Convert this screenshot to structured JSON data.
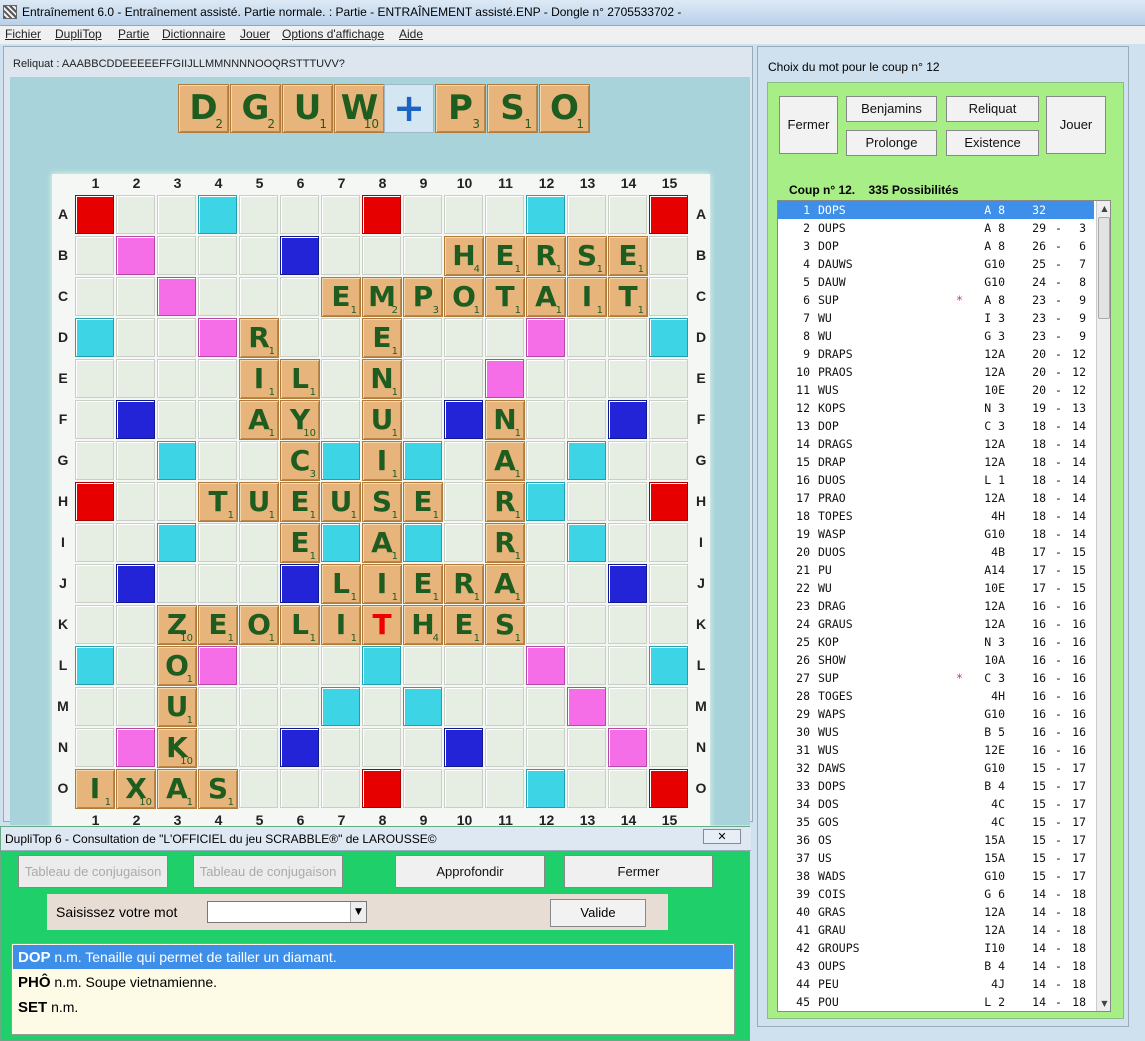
{
  "titlebar": {
    "title": "Entraînement 6.0 - Entraînement assisté. Partie normale. : Partie - ENTRAÎNEMENT assisté.ENP - Dongle n° 2705533702 -"
  },
  "menu": [
    "Fichier",
    "DupliTop",
    "Partie",
    "Dictionnaire",
    "Jouer",
    "Options d'affichage",
    "Aide"
  ],
  "reliquat": "Reliquat : AAABBCDDEEEEEFFGIIJLLMMNNNNOOQRSTTTUVV?",
  "rack": [
    [
      "D",
      "2"
    ],
    [
      "G",
      "2"
    ],
    [
      "U",
      "1"
    ],
    [
      "W",
      "10"
    ],
    [
      "P",
      "3"
    ],
    [
      "S",
      "1"
    ],
    [
      "O",
      "1"
    ]
  ],
  "rack_plus": "+",
  "cols": [
    "1",
    "2",
    "3",
    "4",
    "5",
    "6",
    "7",
    "8",
    "9",
    "10",
    "11",
    "12",
    "13",
    "14",
    "15"
  ],
  "rows": [
    "A",
    "B",
    "C",
    "D",
    "E",
    "F",
    "G",
    "H",
    "I",
    "J",
    "K",
    "L",
    "M",
    "N",
    "O"
  ],
  "colors": {
    "tw": "#e60000",
    "dw": "#f56ee8",
    "tl": "#2323d8",
    "dl": "#3dd5e5",
    "tile": "#e7b57b",
    "letter": "#1f5c1f",
    "selected": "#3d8fe9"
  },
  "placed": [
    [
      "B",
      9,
      "H",
      "4"
    ],
    [
      "B",
      10,
      "E",
      "1"
    ],
    [
      "B",
      11,
      "R",
      "1"
    ],
    [
      "B",
      12,
      "S",
      "1"
    ],
    [
      "B",
      13,
      "E",
      "1"
    ],
    [
      "C",
      6,
      "E",
      "1"
    ],
    [
      "C",
      7,
      "M",
      "2"
    ],
    [
      "C",
      8,
      "P",
      "3"
    ],
    [
      "C",
      9,
      "O",
      "1"
    ],
    [
      "C",
      10,
      "T",
      "1"
    ],
    [
      "C",
      11,
      "A",
      "1"
    ],
    [
      "C",
      12,
      "I",
      "1"
    ],
    [
      "C",
      13,
      "T",
      "1"
    ],
    [
      "D",
      4,
      "R",
      "1"
    ],
    [
      "D",
      7,
      "E",
      "1"
    ],
    [
      "E",
      4,
      "I",
      "1"
    ],
    [
      "E",
      5,
      "L",
      "1"
    ],
    [
      "E",
      7,
      "N",
      "1"
    ],
    [
      "F",
      4,
      "A",
      "1"
    ],
    [
      "F",
      5,
      "Y",
      "10"
    ],
    [
      "F",
      7,
      "U",
      "1"
    ],
    [
      "F",
      10,
      "N",
      "1"
    ],
    [
      "G",
      5,
      "C",
      "3"
    ],
    [
      "G",
      7,
      "I",
      "1"
    ],
    [
      "G",
      10,
      "A",
      "1"
    ],
    [
      "H",
      3,
      "T",
      "1"
    ],
    [
      "H",
      4,
      "U",
      "1"
    ],
    [
      "H",
      5,
      "E",
      "1"
    ],
    [
      "H",
      6,
      "U",
      "1"
    ],
    [
      "H",
      7,
      "S",
      "1"
    ],
    [
      "H",
      8,
      "E",
      "1"
    ],
    [
      "H",
      10,
      "R",
      "1"
    ],
    [
      "I",
      5,
      "E",
      "1"
    ],
    [
      "I",
      7,
      "A",
      "1"
    ],
    [
      "I",
      10,
      "R",
      "1"
    ],
    [
      "J",
      6,
      "L",
      "1"
    ],
    [
      "J",
      7,
      "I",
      "1"
    ],
    [
      "J",
      8,
      "E",
      "1"
    ],
    [
      "J",
      9,
      "R",
      "1"
    ],
    [
      "J",
      10,
      "A",
      "1"
    ],
    [
      "K",
      2,
      "Z",
      "10"
    ],
    [
      "K",
      3,
      "E",
      "1"
    ],
    [
      "K",
      4,
      "O",
      "1"
    ],
    [
      "K",
      5,
      "L",
      "1"
    ],
    [
      "K",
      6,
      "I",
      "1"
    ],
    [
      "K",
      7,
      "T",
      ""
    ],
    [
      "K",
      8,
      "H",
      "4"
    ],
    [
      "K",
      9,
      "E",
      "1"
    ],
    [
      "K",
      10,
      "S",
      "1"
    ],
    [
      "L",
      2,
      "O",
      "1"
    ],
    [
      "M",
      2,
      "U",
      "1"
    ],
    [
      "N",
      2,
      "K",
      "10"
    ],
    [
      "O",
      0,
      "I",
      "1"
    ],
    [
      "O",
      1,
      "X",
      "10"
    ],
    [
      "O",
      2,
      "A",
      "1"
    ],
    [
      "O",
      3,
      "S",
      "1"
    ]
  ],
  "lexique": {
    "title": "DupliTop 6 - Consultation de \"L'OFFICIEL du jeu SCRABBLE®\" de LAROUSSE©",
    "close_x": "✕",
    "btn_conj1": "Tableau de conjugaison",
    "btn_conj2": "Tableau de conjugaison",
    "btn_approfondir": "Approfondir",
    "btn_fermer": "Fermer",
    "saisir_label": "Saisissez votre mot",
    "input_value": "",
    "btn_valide": "Valide",
    "definitions": [
      {
        "word": "DOP",
        "text": " n.m. Tenaille qui permet de tailler un diamant."
      },
      {
        "word": "PHÔ",
        "text": " n.m. Soupe vietnamienne."
      },
      {
        "word": "SET",
        "text": " n.m."
      }
    ]
  },
  "choix": {
    "title": "Choix du mot pour le coup n° 12",
    "btn_fermer": "Fermer",
    "btn_benjamins": "Benjamins",
    "btn_reliquat": "Reliquat",
    "btn_prolonge": "Prolonge",
    "btn_existence": "Existence",
    "btn_jouer": "Jouer",
    "coup_label": "Coup n° 12.",
    "possibilites": "335 Possibilités",
    "moves": [
      [
        "1",
        "DOPS",
        "",
        "A 8",
        "32",
        ""
      ],
      [
        "2",
        "OUPS",
        "",
        "A 8",
        "29",
        "3"
      ],
      [
        "3",
        "DOP",
        "",
        "A 8",
        "26",
        "6"
      ],
      [
        "4",
        "DAUWS",
        "",
        "G10",
        "25",
        "7"
      ],
      [
        "5",
        "DAUW",
        "",
        "G10",
        "24",
        "8"
      ],
      [
        "6",
        "SUP",
        "*",
        "A 8",
        "23",
        "9"
      ],
      [
        "7",
        "WU",
        "",
        "I 3",
        "23",
        "9"
      ],
      [
        "8",
        "WU",
        "",
        "G 3",
        "23",
        "9"
      ],
      [
        "9",
        "DRAPS",
        "",
        "12A",
        "20",
        "12"
      ],
      [
        "10",
        "PRAOS",
        "",
        "12A",
        "20",
        "12"
      ],
      [
        "11",
        "WUS",
        "",
        "10E",
        "20",
        "12"
      ],
      [
        "12",
        "KOPS",
        "",
        "N 3",
        "19",
        "13"
      ],
      [
        "13",
        "DOP",
        "",
        "C 3",
        "18",
        "14"
      ],
      [
        "14",
        "DRAGS",
        "",
        "12A",
        "18",
        "14"
      ],
      [
        "15",
        "DRAP",
        "",
        "12A",
        "18",
        "14"
      ],
      [
        "16",
        "DUOS",
        "",
        "L 1",
        "18",
        "14"
      ],
      [
        "17",
        "PRAO",
        "",
        "12A",
        "18",
        "14"
      ],
      [
        "18",
        "TOPES",
        "",
        "4H",
        "18",
        "14"
      ],
      [
        "19",
        "WASP",
        "",
        "G10",
        "18",
        "14"
      ],
      [
        "20",
        "DUOS",
        "",
        "4B",
        "17",
        "15"
      ],
      [
        "21",
        "PU",
        "",
        "A14",
        "17",
        "15"
      ],
      [
        "22",
        "WU",
        "",
        "10E",
        "17",
        "15"
      ],
      [
        "23",
        "DRAG",
        "",
        "12A",
        "16",
        "16"
      ],
      [
        "24",
        "GRAUS",
        "",
        "12A",
        "16",
        "16"
      ],
      [
        "25",
        "KOP",
        "",
        "N 3",
        "16",
        "16"
      ],
      [
        "26",
        "SHOW",
        "",
        "10A",
        "16",
        "16"
      ],
      [
        "27",
        "SUP",
        "*",
        "C 3",
        "16",
        "16"
      ],
      [
        "28",
        "TOGES",
        "",
        "4H",
        "16",
        "16"
      ],
      [
        "29",
        "WAPS",
        "",
        "G10",
        "16",
        "16"
      ],
      [
        "30",
        "WUS",
        "",
        "B 5",
        "16",
        "16"
      ],
      [
        "31",
        "WUS",
        "",
        "12E",
        "16",
        "16"
      ],
      [
        "32",
        "DAWS",
        "",
        "G10",
        "15",
        "17"
      ],
      [
        "33",
        "DOPS",
        "",
        "B 4",
        "15",
        "17"
      ],
      [
        "34",
        "DOS",
        "",
        "4C",
        "15",
        "17"
      ],
      [
        "35",
        "GOS",
        "",
        "4C",
        "15",
        "17"
      ],
      [
        "36",
        "OS",
        "",
        "15A",
        "15",
        "17"
      ],
      [
        "37",
        "US",
        "",
        "15A",
        "15",
        "17"
      ],
      [
        "38",
        "WADS",
        "",
        "G10",
        "15",
        "17"
      ],
      [
        "39",
        "COIS",
        "",
        "G 6",
        "14",
        "18"
      ],
      [
        "40",
        "GRAS",
        "",
        "12A",
        "14",
        "18"
      ],
      [
        "41",
        "GRAU",
        "",
        "12A",
        "14",
        "18"
      ],
      [
        "42",
        "GROUPS",
        "",
        "I10",
        "14",
        "18"
      ],
      [
        "43",
        "OUPS",
        "",
        "B 4",
        "14",
        "18"
      ],
      [
        "44",
        "PEU",
        "",
        "4J",
        "14",
        "18"
      ],
      [
        "45",
        "POU",
        "",
        "L 2",
        "14",
        "18"
      ]
    ]
  }
}
